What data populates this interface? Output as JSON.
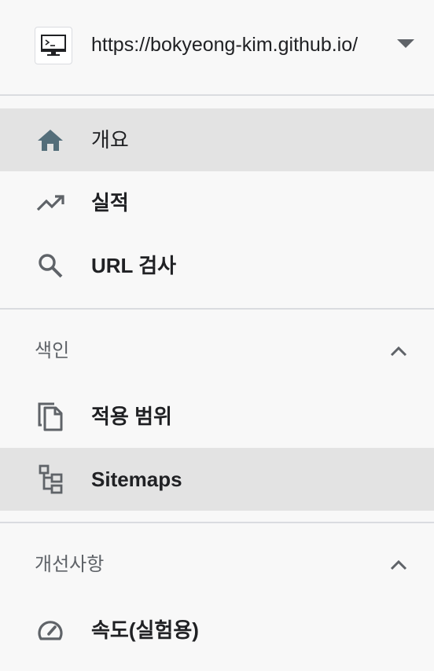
{
  "property": {
    "url": "https://bokyeong-kim.github.io/",
    "icon": "terminal-monitor-icon",
    "dropdown_icon": "caret-down-icon"
  },
  "nav": {
    "overview": {
      "label": "개요",
      "icon": "home-icon"
    },
    "performance": {
      "label": "실적",
      "icon": "trending-up-icon"
    },
    "url_inspection": {
      "label": "URL 검사",
      "icon": "search-icon"
    }
  },
  "sections": {
    "index": {
      "label": "색인",
      "toggle_icon": "chevron-up-icon",
      "items": {
        "coverage": {
          "label": "적용 범위",
          "icon": "copy-pages-icon"
        },
        "sitemaps": {
          "label": "Sitemaps",
          "icon": "sitemap-icon"
        }
      }
    },
    "enhancements": {
      "label": "개선사항",
      "toggle_icon": "chevron-up-icon",
      "items": {
        "speed": {
          "label": "속도(실험용)",
          "icon": "speedometer-icon"
        }
      }
    }
  },
  "colors": {
    "icon_gray": "#5f6368",
    "home_icon": "#546e7a",
    "selected_bg": "#e3e3e3",
    "background": "#f8f8f8"
  }
}
